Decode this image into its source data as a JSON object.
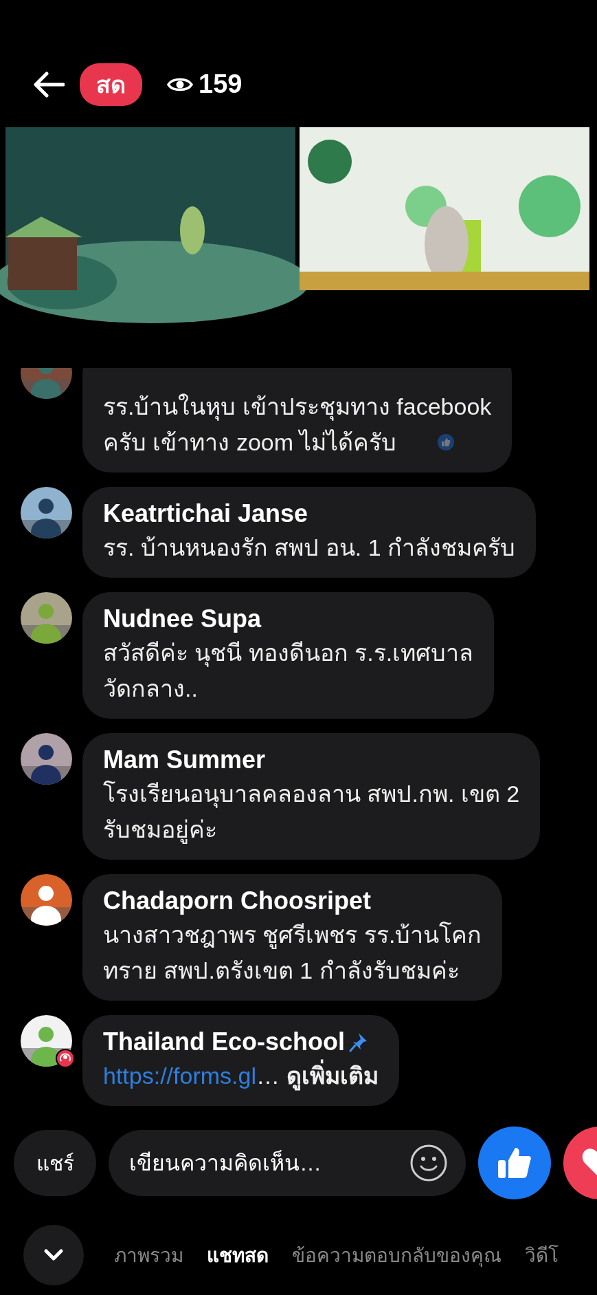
{
  "header": {
    "live_label": "สด",
    "viewers": "159"
  },
  "comments": [
    {
      "lines": [
        "รร.บ้านในหุบ เข้าประชุมทาง facebook",
        "ครับ เข้าทาง zoom ไม่ได้ครับ"
      ],
      "liked": true
    },
    {
      "name": "Keatrtichai Janse",
      "lines": [
        "รร. บ้านหนองรัก สพป อน. 1 กำลังชมครับ"
      ]
    },
    {
      "name": "Nudnee Supa",
      "lines": [
        "สวัสดีค่ะ นุชนี  ทองดีนอก  ร.ร.เทศบาล",
        "วัดกลาง.."
      ]
    },
    {
      "name": "Mam Summer",
      "lines": [
        "โรงเรียนอนุบาลคลองลาน สพป.กพ. เขต 2",
        "รับชมอยู่ค่ะ"
      ]
    },
    {
      "name": "Chadaporn Choosripet",
      "lines": [
        "นางสาวชฎาพร ชูศรีเพชร รร.บ้านโคก",
        "ทราย สพป.ตรังเขต 1 กำลังรับชมค่ะ"
      ]
    },
    {
      "name": "Thailand Eco-school",
      "pinned": true,
      "host": true,
      "link": "https://forms.gl",
      "ellipsis": "…",
      "see_more": "ดูเพิ่มเติม"
    }
  ],
  "composer": {
    "share": "แชร์",
    "placeholder": "เขียนความคิดเห็น…"
  },
  "tabs": [
    {
      "label": "ภาพรวม",
      "selected": false
    },
    {
      "label": "แชทสด",
      "selected": true
    },
    {
      "label": "ข้อความตอบกลับของคุณ",
      "selected": false
    },
    {
      "label": "วิดีโ",
      "selected": false
    }
  ]
}
